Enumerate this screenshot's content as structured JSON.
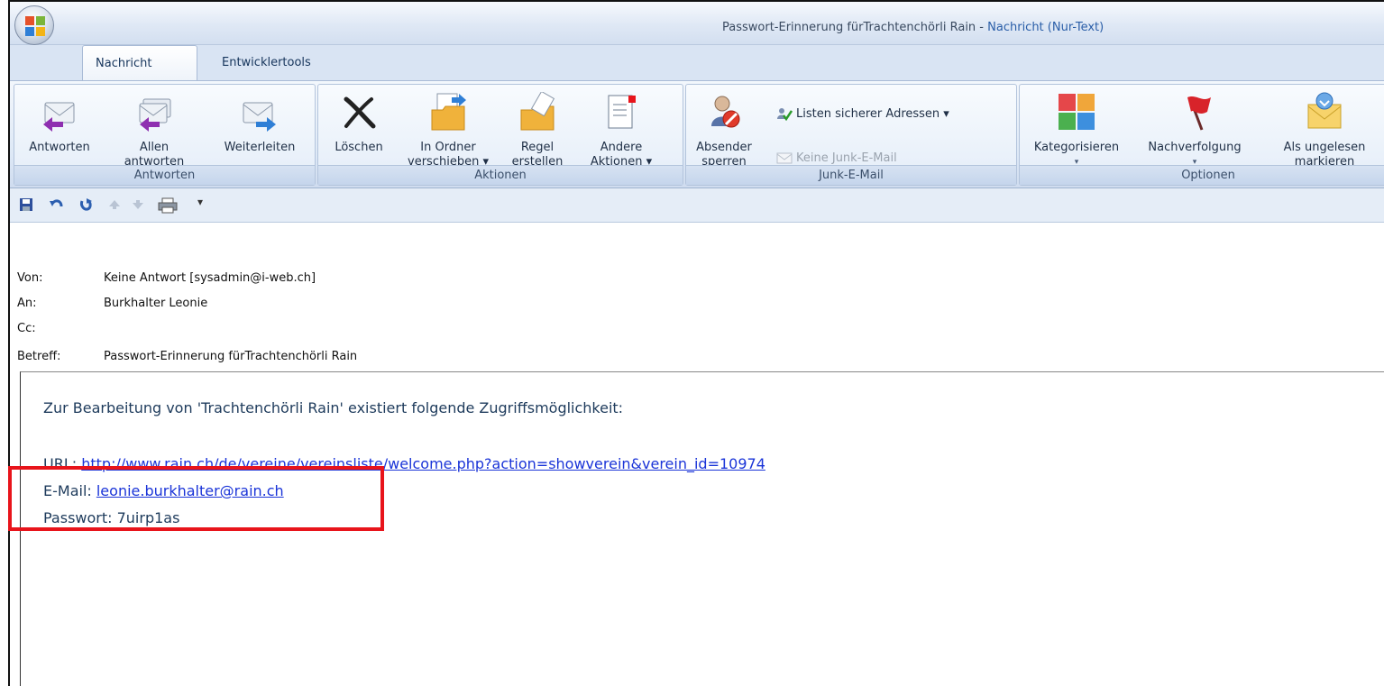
{
  "window": {
    "title": "Passwort-Erinnerung fürTrachtenchörli Rain",
    "title_sep": " - ",
    "title_mode": "Nachricht (Nur-Text)"
  },
  "tabs": [
    {
      "label": "Nachricht",
      "active": true
    },
    {
      "label": "Entwicklertools",
      "active": false
    }
  ],
  "ribbon": {
    "antworten": {
      "label": "Antworten",
      "reply": "Antworten",
      "reply_all_1": "Allen",
      "reply_all_2": "antworten",
      "forward": "Weiterleiten"
    },
    "aktionen": {
      "label": "Aktionen",
      "delete": "Löschen",
      "move_1": "In Ordner",
      "move_2": "verschieben ▾",
      "rule_1": "Regel",
      "rule_2": "erstellen",
      "other_1": "Andere",
      "other_2": "Aktionen ▾"
    },
    "junk": {
      "label": "Junk-E-Mail",
      "block_1": "Absender",
      "block_2": "sperren",
      "safe_lists": "Listen sicherer Adressen ▾",
      "not_junk": "Keine Junk-E-Mail"
    },
    "optionen": {
      "label": "Optionen",
      "categorize": "Kategorisieren",
      "categorize_arrow": "▾",
      "followup": "Nachverfolgung",
      "followup_arrow": "▾",
      "unread_1": "Als ungelesen",
      "unread_2": "markieren"
    }
  },
  "headers": {
    "from_label": "Von:",
    "from_value": "Keine Antwort [sysadmin@i-web.ch]",
    "to_label": "An:",
    "to_value": "Burkhalter Leonie",
    "cc_label": "Cc:",
    "cc_value": "",
    "subject_label": "Betreff:",
    "subject_value": "Passwort-Erinnerung fürTrachtenchörli Rain"
  },
  "body": {
    "intro": "Zur Bearbeitung von 'Trachtenchörli Rain' existiert folgende Zugriffsmöglichkeit:",
    "url_label": "URL: ",
    "url": "http://www.rain.ch/de/vereine/vereinsliste/welcome.php?action=showverein&verein_id=10974",
    "email_label": "E-Mail: ",
    "email": "leonie.burkhalter@rain.ch",
    "password_label": "Passwort: ",
    "password": "7uirp1as"
  },
  "colors": {
    "highlight": "#e8141b",
    "link": "#1a34d8",
    "accent": "#2a5ea8"
  }
}
